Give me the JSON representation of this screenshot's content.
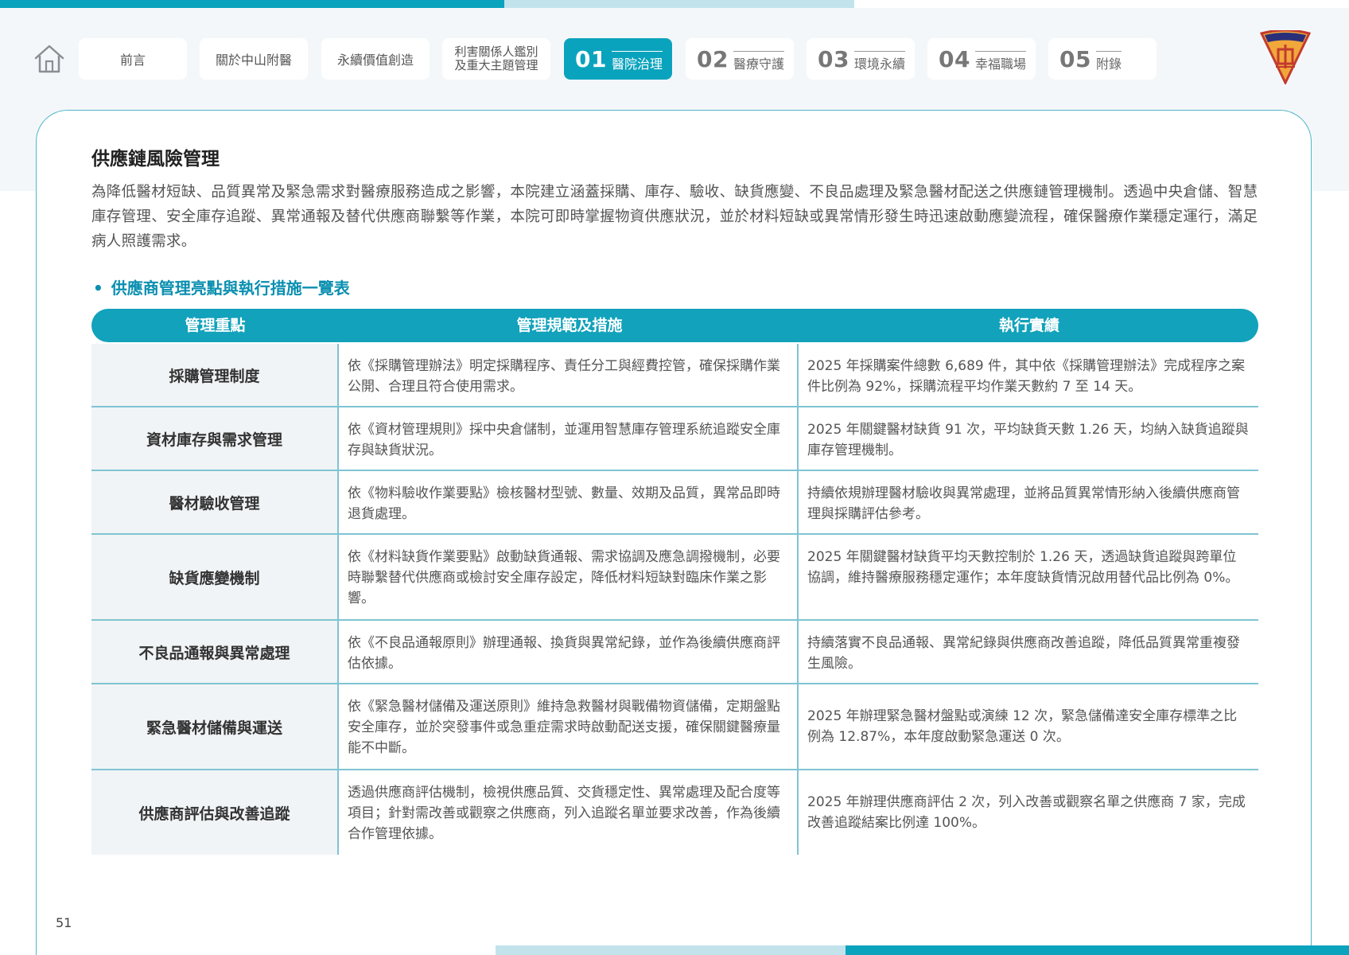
{
  "nav": {
    "tabs": [
      {
        "label": "前言"
      },
      {
        "label": "關於中山附醫"
      },
      {
        "label": "永續價值創造"
      },
      {
        "line1": "利害關係人鑑別",
        "line2": "及重大主題管理"
      },
      {
        "num": "01",
        "label": "醫院治理",
        "active": true
      },
      {
        "num": "02",
        "label": "醫療守護"
      },
      {
        "num": "03",
        "label": "環境永續"
      },
      {
        "num": "04",
        "label": "幸福職場"
      },
      {
        "num": "05",
        "label": "附錄"
      }
    ],
    "logo_text": "中山醫"
  },
  "section": {
    "title": "供應鏈風險管理",
    "intro": "為降低醫材短缺、品質異常及緊急需求對醫療服務造成之影響，本院建立涵蓋採購、庫存、驗收、缺貨應變、不良品處理及緊急醫材配送之供應鏈管理機制。透過中央倉儲、智慧庫存管理、安全庫存追蹤、異常通報及替代供應商聯繫等作業，本院可即時掌握物資供應狀況，並於材料短缺或異常情形發生時迅速啟動應變流程，確保醫療作業穩定運行，滿足病人照護需求。",
    "subhead_bullet": "•",
    "subhead": "供應商管理亮點與執行措施一覽表"
  },
  "table": {
    "headers": [
      "管理重點",
      "管理規範及措施",
      "執行實績"
    ],
    "rows": [
      {
        "key": "採購管理制度",
        "measure": "依《採購管理辦法》明定採購程序、責任分工與經費控管，確保採購作業公開、合理且符合使用需求。",
        "result": "2025 年採購案件總數 6,689 件，其中依《採購管理辦法》完成程序之案件比例為 92%，採購流程平均作業天數約 7 至 14 天。"
      },
      {
        "key": "資材庫存與需求管理",
        "measure": "依《資材管理規則》採中央倉儲制，並運用智慧庫存管理系統追蹤安全庫存與缺貨狀況。",
        "result": "2025 年關鍵醫材缺貨 91 次，平均缺貨天數 1.26 天，均納入缺貨追蹤與庫存管理機制。"
      },
      {
        "key": "醫材驗收管理",
        "measure": "依《物料驗收作業要點》檢核醫材型號、數量、效期及品質，異常品即時退貨處理。",
        "result": "持續依規辦理醫材驗收與異常處理，並將品質異常情形納入後續供應商管理與採購評估參考。"
      },
      {
        "key": "缺貨應變機制",
        "measure": "依《材料缺貨作業要點》啟動缺貨通報、需求協調及應急調撥機制，必要時聯繫替代供應商或檢討安全庫存設定，降低材料短缺對臨床作業之影響。",
        "result": "2025 年關鍵醫材缺貨平均天數控制於 1.26 天，透過缺貨追蹤與跨單位協調，維持醫療服務穩定運作；本年度缺貨情況啟用替代品比例為 0%。"
      },
      {
        "key": "不良品通報與異常處理",
        "measure": "依《不良品通報原則》辦理通報、換貨與異常紀錄，並作為後續供應商評估依據。",
        "result": "持續落實不良品通報、異常紀錄與供應商改善追蹤，降低品質異常重複發生風險。"
      },
      {
        "key": "緊急醫材儲備與運送",
        "measure": "依《緊急醫材儲備及運送原則》維持急救醫材與戰備物資儲備，定期盤點安全庫存，並於突發事件或急重症需求時啟動配送支援，確保關鍵醫療量能不中斷。",
        "result": "2025 年辦理緊急醫材盤點或演練 12 次，緊急儲備達安全庫存標準之比例為 12.87%，本年度啟動緊急運送 0 次。"
      },
      {
        "key": "供應商評估與改善追蹤",
        "measure": "透過供應商評估機制，檢視供應品質、交貨穩定性、異常處理及配合度等項目；針對需改善或觀察之供應商，列入追蹤名單並要求改善，作為後續合作管理依據。",
        "result": "2025 年辦理供應商評估 2 次，列入改善或觀察名單之供應商 7 家，完成改善追蹤結案比例達 100%。"
      }
    ]
  },
  "page_number": "51",
  "colors": {
    "accent": "#0aa3bd",
    "accent_light": "#c2e3ec",
    "subhead": "#0a8fb0"
  }
}
